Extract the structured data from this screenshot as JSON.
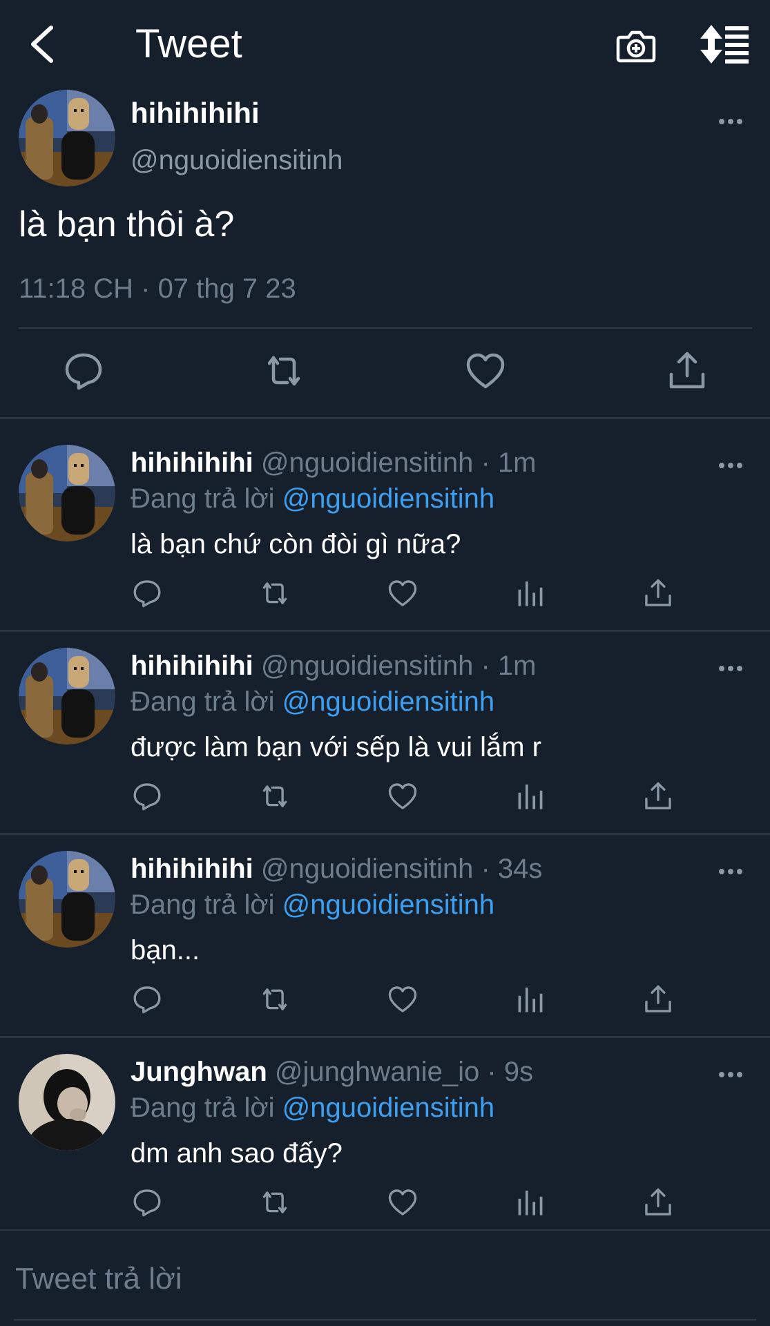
{
  "header": {
    "title": "Tweet",
    "icons": {
      "back": "chevron-left-icon",
      "camera": "camera-add-icon",
      "sort": "sort-icon"
    }
  },
  "main_tweet": {
    "name": "hihihihihi",
    "handle": "@nguoidiensitinh",
    "text": "là bạn thôi à?",
    "timestamp": "11:18 CH · 07 thg 7 23"
  },
  "replies": [
    {
      "name": "hihihihihi",
      "handle": "@nguoidiensitinh",
      "time": "· 1m",
      "replying_prefix": "Đang trả lời",
      "replying_to": "@nguoidiensitinh",
      "text": "là bạn chứ còn đòi gì nữa?"
    },
    {
      "name": "hihihihihi",
      "handle": "@nguoidiensitinh",
      "time": "· 1m",
      "replying_prefix": "Đang trả lời",
      "replying_to": "@nguoidiensitinh",
      "text": "được làm bạn với sếp là vui lắm r"
    },
    {
      "name": "hihihihihi",
      "handle": "@nguoidiensitinh",
      "time": "· 34s",
      "replying_prefix": "Đang trả lời",
      "replying_to": "@nguoidiensitinh",
      "text": "bạn..."
    },
    {
      "name": "Junghwan",
      "handle": "@junghwanie_io",
      "time": "· 9s",
      "replying_prefix": "Đang trả lời",
      "replying_to": "@nguoidiensitinh",
      "text": "dm anh sao đấy?"
    }
  ],
  "composer": {
    "placeholder": "Tweet trả lời"
  },
  "colors": {
    "background": "#16202c",
    "divider": "#2a3643",
    "muted_text": "#6e7d8c",
    "mention": "#3c9ff0",
    "icon": "#8b98a5"
  }
}
